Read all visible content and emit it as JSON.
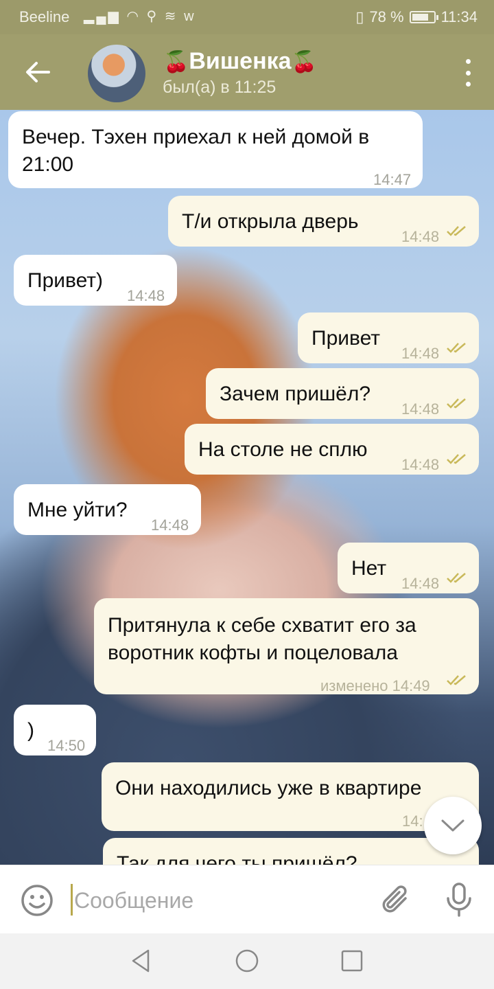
{
  "statusbar": {
    "carrier": "Beeline",
    "battery_text": "78 %",
    "battery_level": 0.78,
    "time": "11:34"
  },
  "header": {
    "cherry": "🍒",
    "title_name": "Вишенка",
    "subtitle": "был(а) в 11:25"
  },
  "messages": [
    {
      "dir": "in",
      "text": "Вечер. Тэхен приехал к ней домой в 21:00",
      "time": "14:47"
    },
    {
      "dir": "out",
      "text": "Т/и открыла дверь",
      "time": "14:48"
    },
    {
      "dir": "in",
      "text": "Привет)",
      "time": "14:48"
    },
    {
      "dir": "out",
      "text": "Привет",
      "time": "14:48"
    },
    {
      "dir": "out",
      "text": "Зачем пришёл?",
      "time": "14:48"
    },
    {
      "dir": "out",
      "text": "На столе не сплю",
      "time": "14:48"
    },
    {
      "dir": "in",
      "text": "Мне уйти?",
      "time": "14:48"
    },
    {
      "dir": "out",
      "text": "Нет",
      "time": "14:48"
    },
    {
      "dir": "out",
      "text": "Притянула к себе схватит его за воротник кофты и поцеловала",
      "time": "изменено 14:49"
    },
    {
      "dir": "in",
      "text": ")",
      "time": "14:50"
    },
    {
      "dir": "out",
      "text": "Они находились уже в квартире",
      "time": "14:"
    },
    {
      "dir": "out",
      "text": "Так для чего ты пришёл?",
      "time": ""
    }
  ],
  "input": {
    "placeholder": "Сообщение",
    "value": ""
  },
  "colors": {
    "header": "#a09e6d",
    "statusbar": "#9c9a6a",
    "outgoing_bubble": "#fbf7e6",
    "incoming_bubble": "#ffffff",
    "ticks": "#c9b95a"
  },
  "icons": [
    "back-arrow-icon",
    "more-vert-icon",
    "double-check-icon",
    "chevron-down-icon",
    "emoji-icon",
    "attach-icon",
    "mic-icon",
    "nav-back-icon",
    "nav-home-icon",
    "nav-recents-icon"
  ]
}
